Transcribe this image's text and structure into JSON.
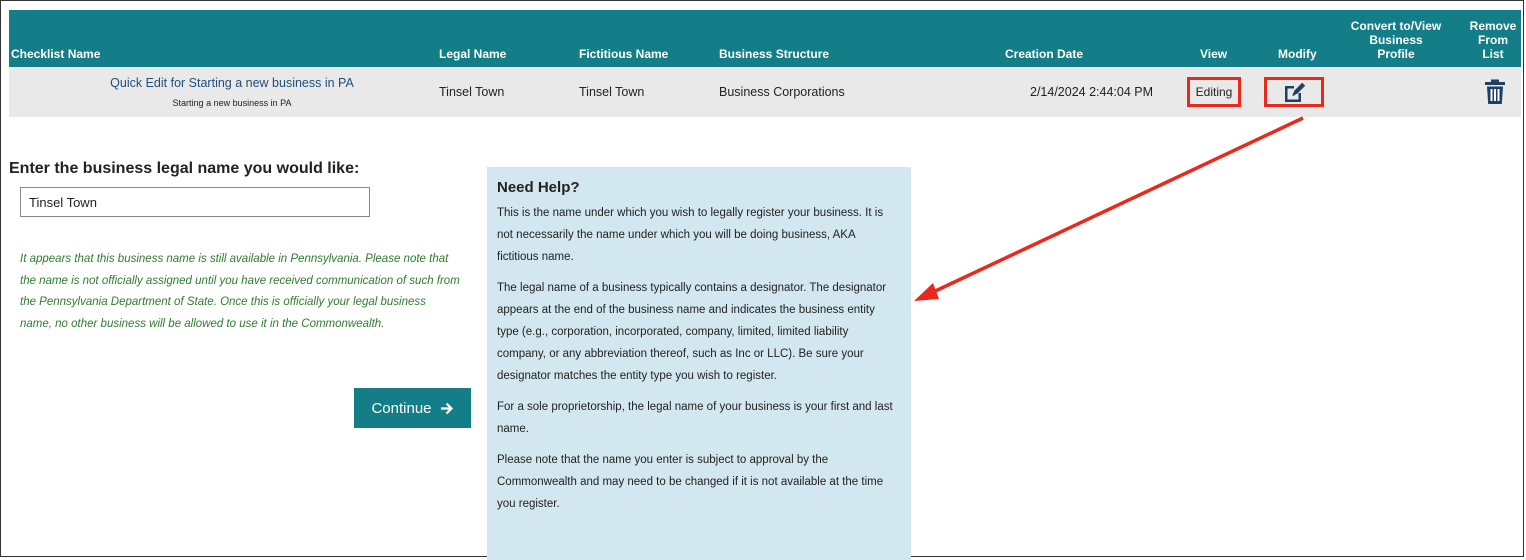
{
  "table": {
    "headers": {
      "checklist_name": "Checklist Name",
      "legal_name": "Legal Name",
      "fictitious_name": "Fictitious Name",
      "business_structure": "Business Structure",
      "creation_date": "Creation Date",
      "view": "View",
      "modify": "Modify",
      "convert": [
        "Convert to/View",
        "Business",
        "Profile"
      ],
      "remove": [
        "Remove",
        "From",
        "List"
      ]
    },
    "row": {
      "checklist_link": "Quick Edit for Starting a new business in PA",
      "checklist_sub": "Starting a new business in PA",
      "legal_name": "Tinsel Town",
      "fictitious_name": "Tinsel Town",
      "business_structure": "Business Corporations",
      "creation_date": "2/14/2024 2:44:04 PM",
      "view": "Editing",
      "modify_icon": "edit-icon",
      "remove_icon": "trash-icon"
    }
  },
  "form": {
    "heading": "Enter the business legal name you would like:",
    "input_value": "Tinsel Town",
    "availability_message": "It appears that this business name is still available in Pennsylvania. Please note that the name is not officially assigned until you have received communication of such from the Pennsylvania Department of State. Once this is officially your legal business name, no other business will be allowed to use it in the Commonwealth.",
    "continue_label": "Continue"
  },
  "help": {
    "title": "Need Help?",
    "paragraphs": [
      "This is the name under which you wish to legally register your business. It is not necessarily the name under which you will be doing business, AKA fictitious name.",
      "The legal name of a business typically contains a designator. The designator appears at the end of the business name and indicates the business entity type (e.g., corporation, incorporated, company, limited, limited liability company, or any abbreviation thereof, such as Inc or LLC). Be sure your designator matches the entity type you wish to register.",
      "For a sole proprietorship, the legal name of your business is your first and last name.",
      "Please note that the name you enter is subject to approval by the Commonwealth and may need to be changed if it is not available at the time you register."
    ]
  },
  "colors": {
    "header_teal": "#137d88",
    "annotation_red": "#e8291c",
    "help_bg": "#d2e7ef",
    "success_green": "#2e7d2e"
  }
}
